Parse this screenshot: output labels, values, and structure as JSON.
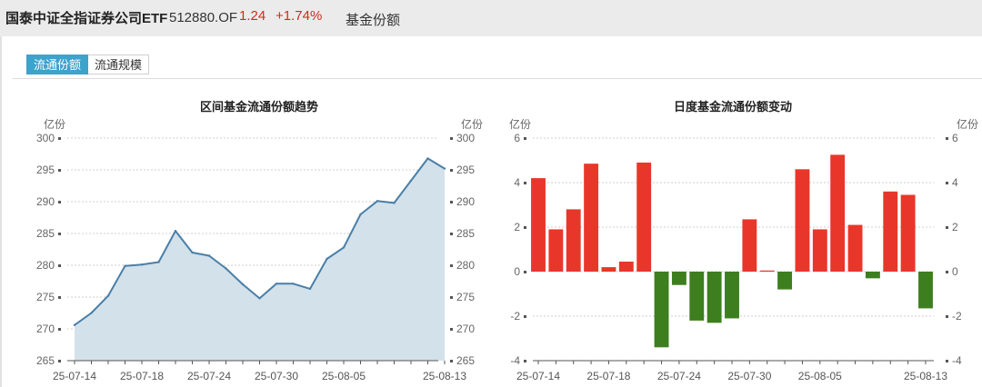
{
  "header": {
    "fund_name": "国泰中证全指证券公司ETF",
    "fund_code": "512880.OF",
    "price": "1.24",
    "change_pct": "+1.74%",
    "section_label": "基金份额"
  },
  "tabs": [
    {
      "label": "流通份额",
      "active": true
    },
    {
      "label": "流通规模",
      "active": false
    }
  ],
  "colors": {
    "line": "#4a7fa7",
    "area": "#d3e1ea",
    "positive": "#e8372a",
    "negative": "#3d7f1f",
    "tab_active": "#3da3cb"
  },
  "chart_data": [
    {
      "type": "area",
      "title": "区间基金流通份额趋势",
      "ylabel_left": "亿份",
      "ylabel_right": "亿份",
      "ylim": [
        265,
        300
      ],
      "yticks": [
        265,
        270,
        275,
        280,
        285,
        290,
        295,
        300
      ],
      "grid": true,
      "x": [
        "2025-07-14",
        "2025-07-15",
        "2025-07-16",
        "2025-07-17",
        "2025-07-18",
        "2025-07-21",
        "2025-07-22",
        "2025-07-23",
        "2025-07-24",
        "2025-07-25",
        "2025-07-28",
        "2025-07-29",
        "2025-07-30",
        "2025-07-31",
        "2025-08-01",
        "2025-08-04",
        "2025-08-05",
        "2025-08-06",
        "2025-08-07",
        "2025-08-08",
        "2025-08-11",
        "2025-08-12",
        "2025-08-13"
      ],
      "values": [
        270.6,
        272.5,
        275.2,
        279.9,
        280.1,
        280.5,
        285.4,
        282.0,
        281.5,
        279.5,
        277.0,
        274.8,
        277.1,
        277.1,
        276.3,
        281.0,
        282.8,
        288.0,
        290.1,
        289.8,
        293.3,
        296.8,
        295.2
      ],
      "xtick_labels": [
        "25-07-14",
        "25-07-18",
        "25-07-24",
        "25-07-30",
        "25-08-05",
        "25-08-13"
      ],
      "xtick_indices": [
        0,
        4,
        8,
        12,
        16,
        22
      ]
    },
    {
      "type": "bar",
      "title": "日度基金流通份额变动",
      "ylabel_left": "亿份",
      "ylabel_right": "亿份",
      "ylim": [
        -4,
        6
      ],
      "yticks": [
        -4,
        -2,
        0,
        2,
        4,
        6
      ],
      "grid": true,
      "x": [
        "2025-07-14",
        "2025-07-15",
        "2025-07-16",
        "2025-07-17",
        "2025-07-18",
        "2025-07-21",
        "2025-07-22",
        "2025-07-23",
        "2025-07-24",
        "2025-07-25",
        "2025-07-28",
        "2025-07-29",
        "2025-07-30",
        "2025-07-31",
        "2025-08-01",
        "2025-08-04",
        "2025-08-05",
        "2025-08-06",
        "2025-08-07",
        "2025-08-08",
        "2025-08-11",
        "2025-08-12",
        "2025-08-13"
      ],
      "values": [
        4.2,
        1.9,
        2.8,
        4.85,
        0.2,
        0.45,
        4.9,
        -3.4,
        -0.6,
        -2.2,
        -2.3,
        -2.1,
        2.35,
        0.05,
        -0.8,
        4.6,
        1.9,
        5.25,
        2.1,
        -0.3,
        3.6,
        3.45,
        -1.65
      ],
      "xtick_labels": [
        "25-07-14",
        "25-07-18",
        "25-07-24",
        "25-07-30",
        "25-08-05",
        "25-08-13"
      ],
      "xtick_indices": [
        0,
        4,
        8,
        12,
        16,
        22
      ]
    }
  ]
}
